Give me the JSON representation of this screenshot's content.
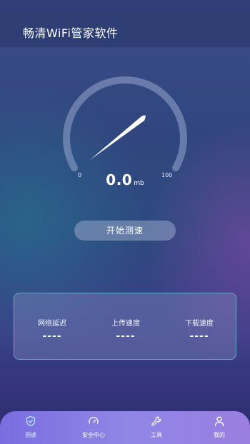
{
  "app": {
    "title": "畅清WiFi管家软件"
  },
  "gauge": {
    "min_label": "0",
    "max_label": "100",
    "value": 0.0
  },
  "speed": {
    "value": "0.0",
    "unit": "mb"
  },
  "actions": {
    "start_label": "开始测速"
  },
  "stats": [
    {
      "label": "网络延迟",
      "value": "----"
    },
    {
      "label": "上传速度",
      "value": "----"
    },
    {
      "label": "下载速度",
      "value": "----"
    }
  ],
  "tabbar": {
    "active": "测速",
    "items": [
      {
        "label": "测速",
        "icon": "shield-icon"
      },
      {
        "label": "安全中心",
        "icon": "speedometer-icon"
      },
      {
        "label": "工具",
        "icon": "wrench-icon"
      },
      {
        "label": "我的",
        "icon": "user-icon"
      }
    ]
  },
  "colors": {
    "tab_bar": "#8f86e6",
    "card_border": "#78d2e6",
    "button": "#96a5c8"
  }
}
